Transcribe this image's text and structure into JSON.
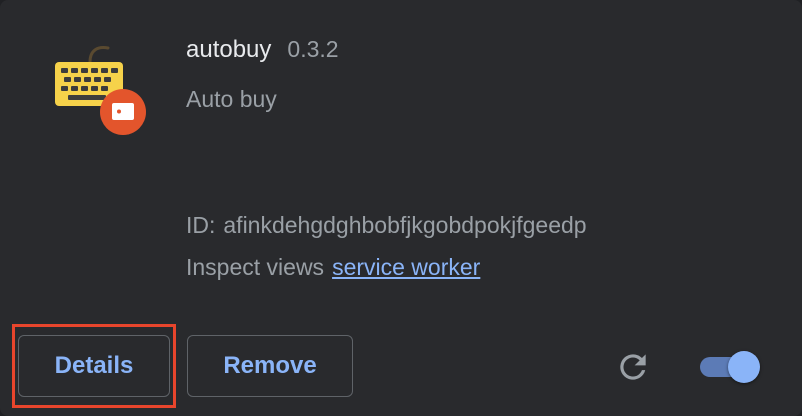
{
  "extension": {
    "name": "autobuy",
    "version": "0.3.2",
    "description": "Auto buy",
    "id_label": "ID:",
    "id_value": "afinkdehgdghbobfjkgobdpokjfgeedp",
    "inspect_label": "Inspect views",
    "inspect_link": "service worker",
    "icon": "keyboard-icon-with-badge",
    "enabled": true
  },
  "buttons": {
    "details_label": "Details",
    "remove_label": "Remove"
  },
  "colors": {
    "background": "#202124",
    "card": "#292a2d",
    "accent": "#8ab4f8",
    "highlight": "#e8452c",
    "keyboard": "#f6d24a",
    "badge": "#e3552c"
  }
}
